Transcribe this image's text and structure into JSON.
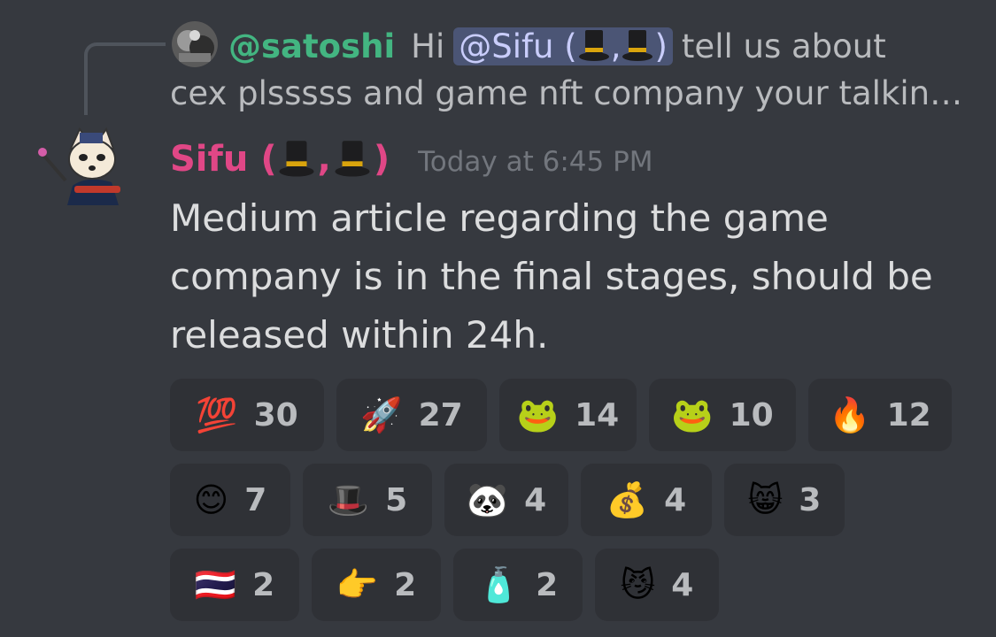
{
  "reply": {
    "author": "@satoshi",
    "greeting": "Hi",
    "mention": "@Sifu (",
    "mention_sep": ",",
    "mention_close": ")",
    "text_after": "tell us about",
    "line2": "cex plsssss and game nft company your talkin…"
  },
  "message": {
    "author_name": "Sifu (",
    "author_sep": ",",
    "author_close": ")",
    "timestamp": "Today at 6:45 PM",
    "content": "Medium article regarding the game company is in the final stages, should be released within 24h."
  },
  "colors": {
    "background": "#36393f",
    "author": "#e04786",
    "reply_author": "#43b581",
    "reaction_bg": "#2f3136",
    "mention_bg": "#4a5180"
  },
  "reactions": {
    "row1": [
      {
        "emoji": "💯",
        "icon": "hundred-points-icon",
        "count": "30"
      },
      {
        "emoji": "🚀",
        "icon": "rocket-icon",
        "count": "27"
      },
      {
        "emoji": "🐸",
        "icon": "pepe-frog-icon",
        "count": "14"
      },
      {
        "emoji": "🐸",
        "icon": "frog-face-icon",
        "count": "10"
      },
      {
        "emoji": "🔥",
        "icon": "fire-icon",
        "count": "12"
      }
    ],
    "row2": [
      {
        "emoji": "😊",
        "icon": "alice-face-icon",
        "count": "7"
      },
      {
        "emoji": "🎩",
        "icon": "top-hat-icon",
        "count": "5"
      },
      {
        "emoji": "🐼",
        "icon": "sifu-panda-icon",
        "count": "4"
      },
      {
        "emoji": "💰",
        "icon": "money-bag-icon",
        "count": "4"
      },
      {
        "emoji": "😸",
        "icon": "cheshire-cat-icon",
        "count": "3"
      }
    ],
    "row3": [
      {
        "emoji": "🇹🇭",
        "icon": "thailand-flag-icon",
        "count": "2"
      },
      {
        "emoji": "👉",
        "icon": "pointing-right-icon",
        "count": "2"
      },
      {
        "emoji": "🧴",
        "icon": "lotion-bottle-icon",
        "count": "2"
      },
      {
        "emoji": "😼",
        "icon": "black-cat-grin-icon",
        "count": "4"
      }
    ]
  }
}
